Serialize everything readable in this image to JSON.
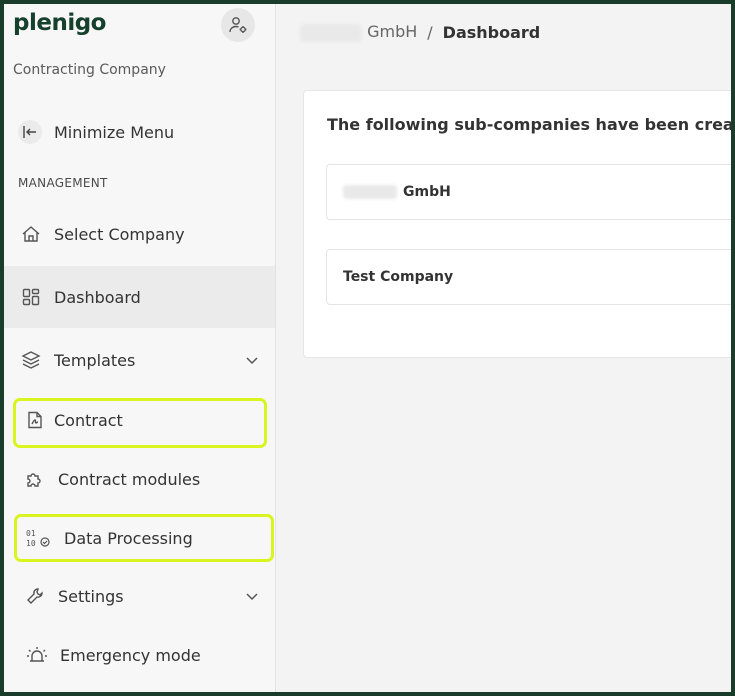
{
  "app": {
    "logo": "plenigo",
    "company_type": "Contracting Company"
  },
  "sidebar": {
    "minimize_label": "Minimize Menu",
    "section_label": "MANAGEMENT",
    "items": [
      {
        "label": "Select Company",
        "icon": "home-icon"
      },
      {
        "label": "Dashboard",
        "icon": "dashboard-icon",
        "active": true
      },
      {
        "label": "Templates",
        "icon": "layers-icon",
        "expandable": true
      },
      {
        "label": "Contract",
        "icon": "document-icon",
        "highlighted": true
      },
      {
        "label": "Contract modules",
        "icon": "puzzle-icon"
      },
      {
        "label": "Data Processing",
        "icon": "binary-check-icon",
        "highlighted": true
      },
      {
        "label": "Settings",
        "icon": "wrench-icon",
        "expandable": true
      },
      {
        "label": "Emergency mode",
        "icon": "siren-icon"
      }
    ]
  },
  "breadcrumb": {
    "company_suffix": "GmbH",
    "separator": "/",
    "current": "Dashboard"
  },
  "main": {
    "card_title": "The following sub-companies have been created",
    "subcompanies": [
      {
        "name": "GmbH",
        "name_partially_redacted": true
      },
      {
        "name": "Test Company"
      }
    ]
  },
  "colors": {
    "brand": "#15402c",
    "highlight": "#d9f41e",
    "frame": "#1a3d2b"
  }
}
